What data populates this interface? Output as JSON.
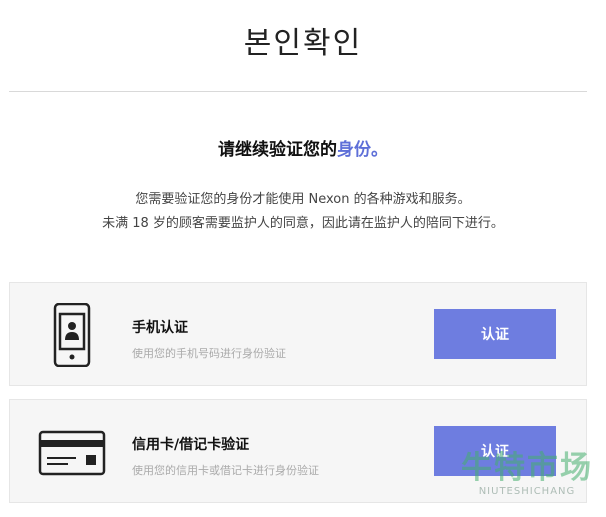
{
  "page": {
    "title": "본인확인",
    "heading_main": "请继续验证您的",
    "heading_accent": "身份",
    "heading_suffix": "。",
    "description_line1": "您需要验证您的身份才能使用 Nexon 的各种游戏和服务。",
    "description_line2": "未满 18 岁的顾客需要监护人的同意，因此请在监护人的陪同下进行。"
  },
  "methods": [
    {
      "icon": "phone-icon",
      "title": "手机认证",
      "description": "使用您的手机号码进行身份验证",
      "button_label": "认证"
    },
    {
      "icon": "credit-card-icon",
      "title": "信用卡/借记卡验证",
      "description": "使用您的信用卡或借记卡进行身份验证",
      "button_label": "认证"
    }
  ],
  "watermark": {
    "main": "牛特市场",
    "sub": "NIUTESHICHANG"
  },
  "colors": {
    "accent": "#5e6fd8",
    "button": "#6e7de0",
    "card_background": "#f6f6f6"
  }
}
